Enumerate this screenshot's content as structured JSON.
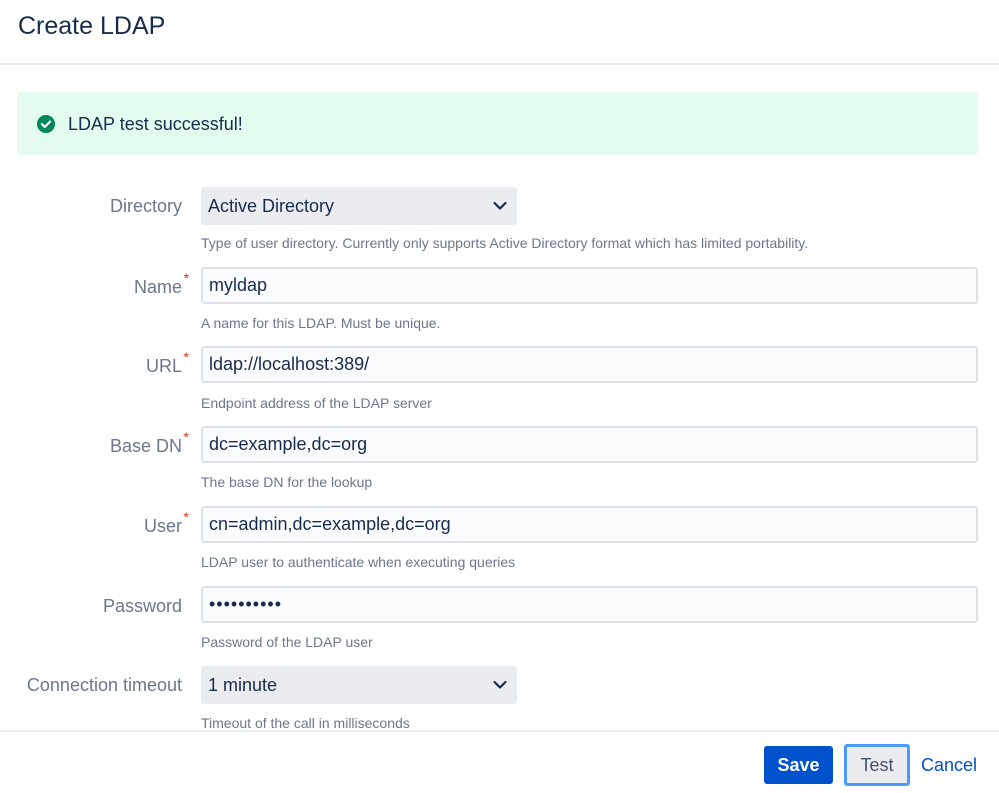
{
  "dialog": {
    "title": "Create LDAP"
  },
  "banner": {
    "icon": "check-circle-icon",
    "message": "LDAP test successful!",
    "color": "#00875a",
    "background": "#e3fcef"
  },
  "form": {
    "directory": {
      "label": "Directory",
      "value": "Active Directory",
      "help": "Type of user directory. Currently only supports Active Directory format which has limited portability."
    },
    "name": {
      "label": "Name",
      "required": "*",
      "value": "myldap",
      "help": "A name for this LDAP. Must be unique."
    },
    "url": {
      "label": "URL",
      "required": "*",
      "value": "ldap://localhost:389/",
      "help": "Endpoint address of the LDAP server"
    },
    "base_dn": {
      "label": "Base DN",
      "required": "*",
      "value": "dc=example,dc=org",
      "help": "The base DN for the lookup"
    },
    "user": {
      "label": "User",
      "required": "*",
      "value": "cn=admin,dc=example,dc=org",
      "help": "LDAP user to authenticate when executing queries"
    },
    "password": {
      "label": "Password",
      "value": "••••••••••",
      "help": "Password of the LDAP user"
    },
    "timeout": {
      "label": "Connection timeout",
      "value": "1 minute",
      "help": "Timeout of the call in milliseconds"
    }
  },
  "footer": {
    "save_label": "Save",
    "test_label": "Test",
    "cancel_label": "Cancel"
  },
  "colors": {
    "primary": "#0052cc",
    "focus_ring": "#4c9aff",
    "required": "#de350b"
  }
}
